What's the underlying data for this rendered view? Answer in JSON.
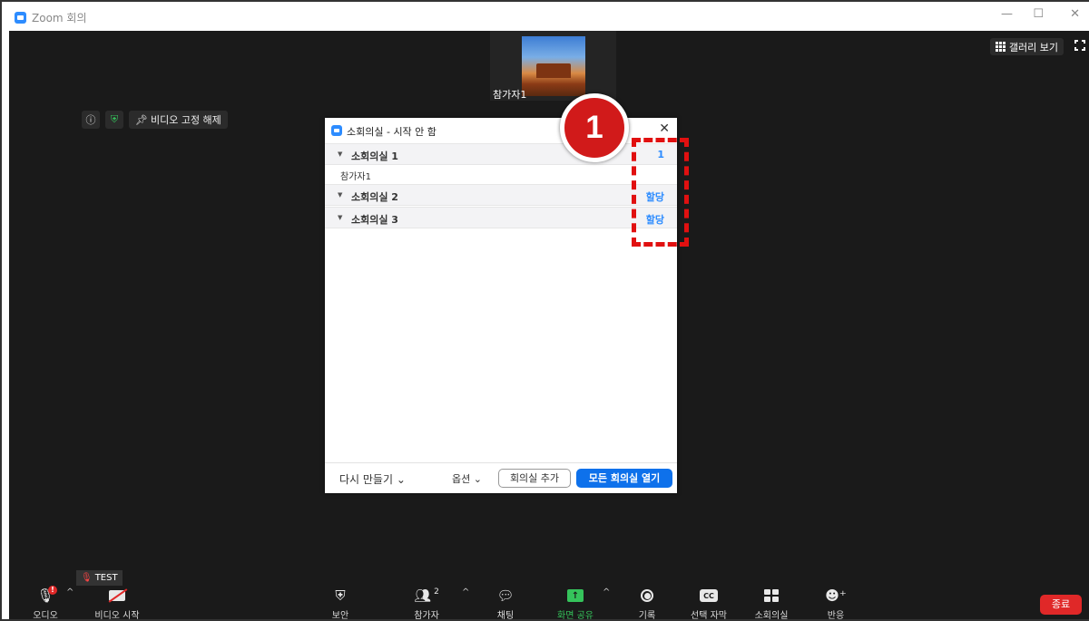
{
  "window": {
    "title": "Zoom 회의",
    "minimize": "—",
    "maximize": "☐",
    "close": "✕"
  },
  "video": {
    "participant_name": "참가자1",
    "unpin_label": "비디오 고정 해제",
    "gallery_label": "갤러리 보기"
  },
  "breakout_dialog": {
    "title": "소회의실 - 시작 안 함",
    "close": "✕",
    "rooms": [
      {
        "name": "소회의실 1",
        "action": "1",
        "participants": [
          "참가자1"
        ]
      },
      {
        "name": "소회의실 2",
        "action": "할당",
        "participants": []
      },
      {
        "name": "소회의실 3",
        "action": "할당",
        "participants": []
      }
    ],
    "footer": {
      "recreate": "다시 만들기 ⌄",
      "options": "옵션 ⌄",
      "add_room": "회의실 추가",
      "open_all": "모든 회의실 열기"
    }
  },
  "callout": {
    "number": "1"
  },
  "toolbar": {
    "test_tag": "TEST",
    "audio": "오디오",
    "video_start": "비디오 시작",
    "security": "보안",
    "participants": "참가자",
    "participants_count": "2",
    "chat": "채팅",
    "share_screen": "화면 공유",
    "record": "기록",
    "captions": "선택 자막",
    "breakout": "소회의실",
    "reactions": "반응",
    "end": "종료",
    "cc_text": "CC",
    "badge": "!"
  },
  "colors": {
    "accent": "#2d8cff",
    "share_green": "#35c35b",
    "end_red": "#e02828",
    "callout_red": "#d11a1a"
  }
}
